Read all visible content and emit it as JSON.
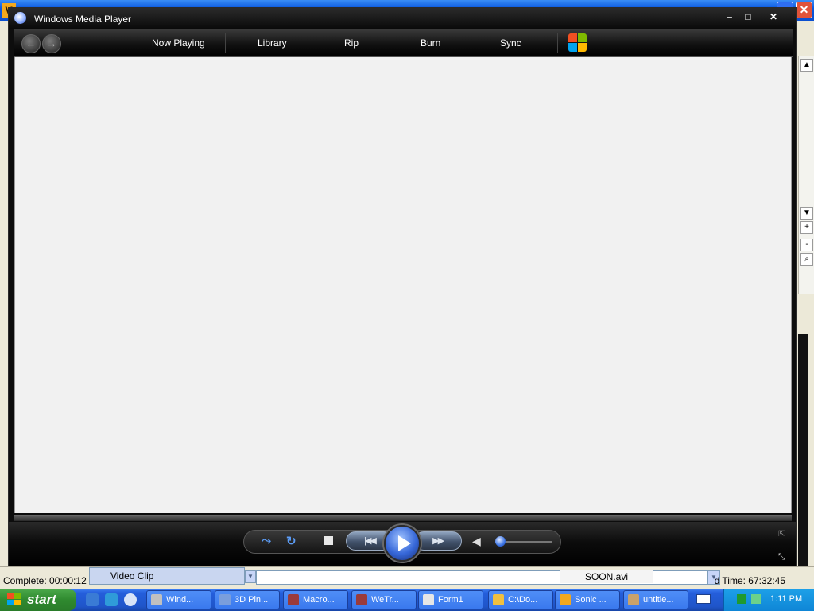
{
  "wmp": {
    "title": "Windows Media Player",
    "window_buttons": {
      "minimize": "–",
      "maximize": "□",
      "close": "✕"
    },
    "nav": {
      "back": "←",
      "forward": "→"
    },
    "tabs": [
      "Now Playing",
      "Library",
      "Rip",
      "Burn",
      "Sync"
    ],
    "controls": {
      "shuffle": "⤳",
      "repeat": "↻",
      "prev": "|◀◀",
      "next": "▶▶|",
      "volume_icon": "◀",
      "volume_level": 0.02
    }
  },
  "background_app": {
    "status": {
      "complete": "Complete: 00:00:12",
      "clip_type": "Video Clip",
      "file": "SOON.avi",
      "time": "d Time: 67:32:45"
    },
    "scroll_buttons": [
      "▲",
      "▼",
      "+",
      "-",
      "⌕"
    ]
  },
  "taskbar": {
    "start": "start",
    "buttons": [
      {
        "label": "Wind...",
        "color": "#c0c0c0"
      },
      {
        "label": "3D Pin...",
        "color": "#7a9edc"
      },
      {
        "label": "Macro...",
        "color": "#9a3b3b"
      },
      {
        "label": "WeTr...",
        "color": "#9a3b3b"
      },
      {
        "label": "Form1",
        "color": "#e6e6e6"
      },
      {
        "label": "C:\\Do...",
        "color": "#f0c040"
      },
      {
        "label": "Sonic ...",
        "color": "#f2a81e"
      },
      {
        "label": "untitle...",
        "color": "#c9a26a"
      }
    ],
    "clock": "1:11 PM"
  },
  "colors": {
    "wmp_accent": "#3667d8",
    "taskbar_blue": "#245edb",
    "start_green": "#2f8a2f"
  }
}
